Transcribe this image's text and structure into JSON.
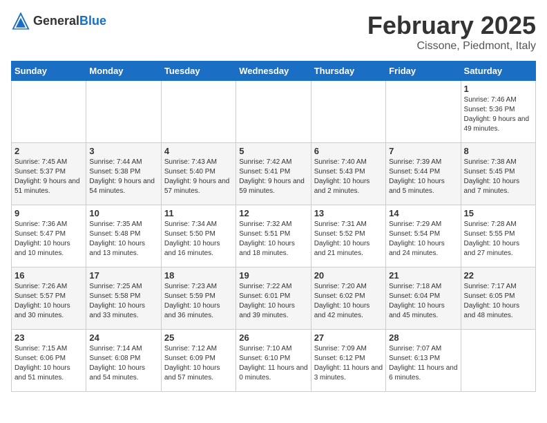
{
  "header": {
    "logo_general": "General",
    "logo_blue": "Blue",
    "month_title": "February 2025",
    "location": "Cissone, Piedmont, Italy"
  },
  "weekdays": [
    "Sunday",
    "Monday",
    "Tuesday",
    "Wednesday",
    "Thursday",
    "Friday",
    "Saturday"
  ],
  "weeks": [
    [
      {
        "day": "",
        "detail": ""
      },
      {
        "day": "",
        "detail": ""
      },
      {
        "day": "",
        "detail": ""
      },
      {
        "day": "",
        "detail": ""
      },
      {
        "day": "",
        "detail": ""
      },
      {
        "day": "",
        "detail": ""
      },
      {
        "day": "1",
        "detail": "Sunrise: 7:46 AM\nSunset: 5:36 PM\nDaylight: 9 hours and 49 minutes."
      }
    ],
    [
      {
        "day": "2",
        "detail": "Sunrise: 7:45 AM\nSunset: 5:37 PM\nDaylight: 9 hours and 51 minutes."
      },
      {
        "day": "3",
        "detail": "Sunrise: 7:44 AM\nSunset: 5:38 PM\nDaylight: 9 hours and 54 minutes."
      },
      {
        "day": "4",
        "detail": "Sunrise: 7:43 AM\nSunset: 5:40 PM\nDaylight: 9 hours and 57 minutes."
      },
      {
        "day": "5",
        "detail": "Sunrise: 7:42 AM\nSunset: 5:41 PM\nDaylight: 9 hours and 59 minutes."
      },
      {
        "day": "6",
        "detail": "Sunrise: 7:40 AM\nSunset: 5:43 PM\nDaylight: 10 hours and 2 minutes."
      },
      {
        "day": "7",
        "detail": "Sunrise: 7:39 AM\nSunset: 5:44 PM\nDaylight: 10 hours and 5 minutes."
      },
      {
        "day": "8",
        "detail": "Sunrise: 7:38 AM\nSunset: 5:45 PM\nDaylight: 10 hours and 7 minutes."
      }
    ],
    [
      {
        "day": "9",
        "detail": "Sunrise: 7:36 AM\nSunset: 5:47 PM\nDaylight: 10 hours and 10 minutes."
      },
      {
        "day": "10",
        "detail": "Sunrise: 7:35 AM\nSunset: 5:48 PM\nDaylight: 10 hours and 13 minutes."
      },
      {
        "day": "11",
        "detail": "Sunrise: 7:34 AM\nSunset: 5:50 PM\nDaylight: 10 hours and 16 minutes."
      },
      {
        "day": "12",
        "detail": "Sunrise: 7:32 AM\nSunset: 5:51 PM\nDaylight: 10 hours and 18 minutes."
      },
      {
        "day": "13",
        "detail": "Sunrise: 7:31 AM\nSunset: 5:52 PM\nDaylight: 10 hours and 21 minutes."
      },
      {
        "day": "14",
        "detail": "Sunrise: 7:29 AM\nSunset: 5:54 PM\nDaylight: 10 hours and 24 minutes."
      },
      {
        "day": "15",
        "detail": "Sunrise: 7:28 AM\nSunset: 5:55 PM\nDaylight: 10 hours and 27 minutes."
      }
    ],
    [
      {
        "day": "16",
        "detail": "Sunrise: 7:26 AM\nSunset: 5:57 PM\nDaylight: 10 hours and 30 minutes."
      },
      {
        "day": "17",
        "detail": "Sunrise: 7:25 AM\nSunset: 5:58 PM\nDaylight: 10 hours and 33 minutes."
      },
      {
        "day": "18",
        "detail": "Sunrise: 7:23 AM\nSunset: 5:59 PM\nDaylight: 10 hours and 36 minutes."
      },
      {
        "day": "19",
        "detail": "Sunrise: 7:22 AM\nSunset: 6:01 PM\nDaylight: 10 hours and 39 minutes."
      },
      {
        "day": "20",
        "detail": "Sunrise: 7:20 AM\nSunset: 6:02 PM\nDaylight: 10 hours and 42 minutes."
      },
      {
        "day": "21",
        "detail": "Sunrise: 7:18 AM\nSunset: 6:04 PM\nDaylight: 10 hours and 45 minutes."
      },
      {
        "day": "22",
        "detail": "Sunrise: 7:17 AM\nSunset: 6:05 PM\nDaylight: 10 hours and 48 minutes."
      }
    ],
    [
      {
        "day": "23",
        "detail": "Sunrise: 7:15 AM\nSunset: 6:06 PM\nDaylight: 10 hours and 51 minutes."
      },
      {
        "day": "24",
        "detail": "Sunrise: 7:14 AM\nSunset: 6:08 PM\nDaylight: 10 hours and 54 minutes."
      },
      {
        "day": "25",
        "detail": "Sunrise: 7:12 AM\nSunset: 6:09 PM\nDaylight: 10 hours and 57 minutes."
      },
      {
        "day": "26",
        "detail": "Sunrise: 7:10 AM\nSunset: 6:10 PM\nDaylight: 11 hours and 0 minutes."
      },
      {
        "day": "27",
        "detail": "Sunrise: 7:09 AM\nSunset: 6:12 PM\nDaylight: 11 hours and 3 minutes."
      },
      {
        "day": "28",
        "detail": "Sunrise: 7:07 AM\nSunset: 6:13 PM\nDaylight: 11 hours and 6 minutes."
      },
      {
        "day": "",
        "detail": ""
      }
    ]
  ]
}
